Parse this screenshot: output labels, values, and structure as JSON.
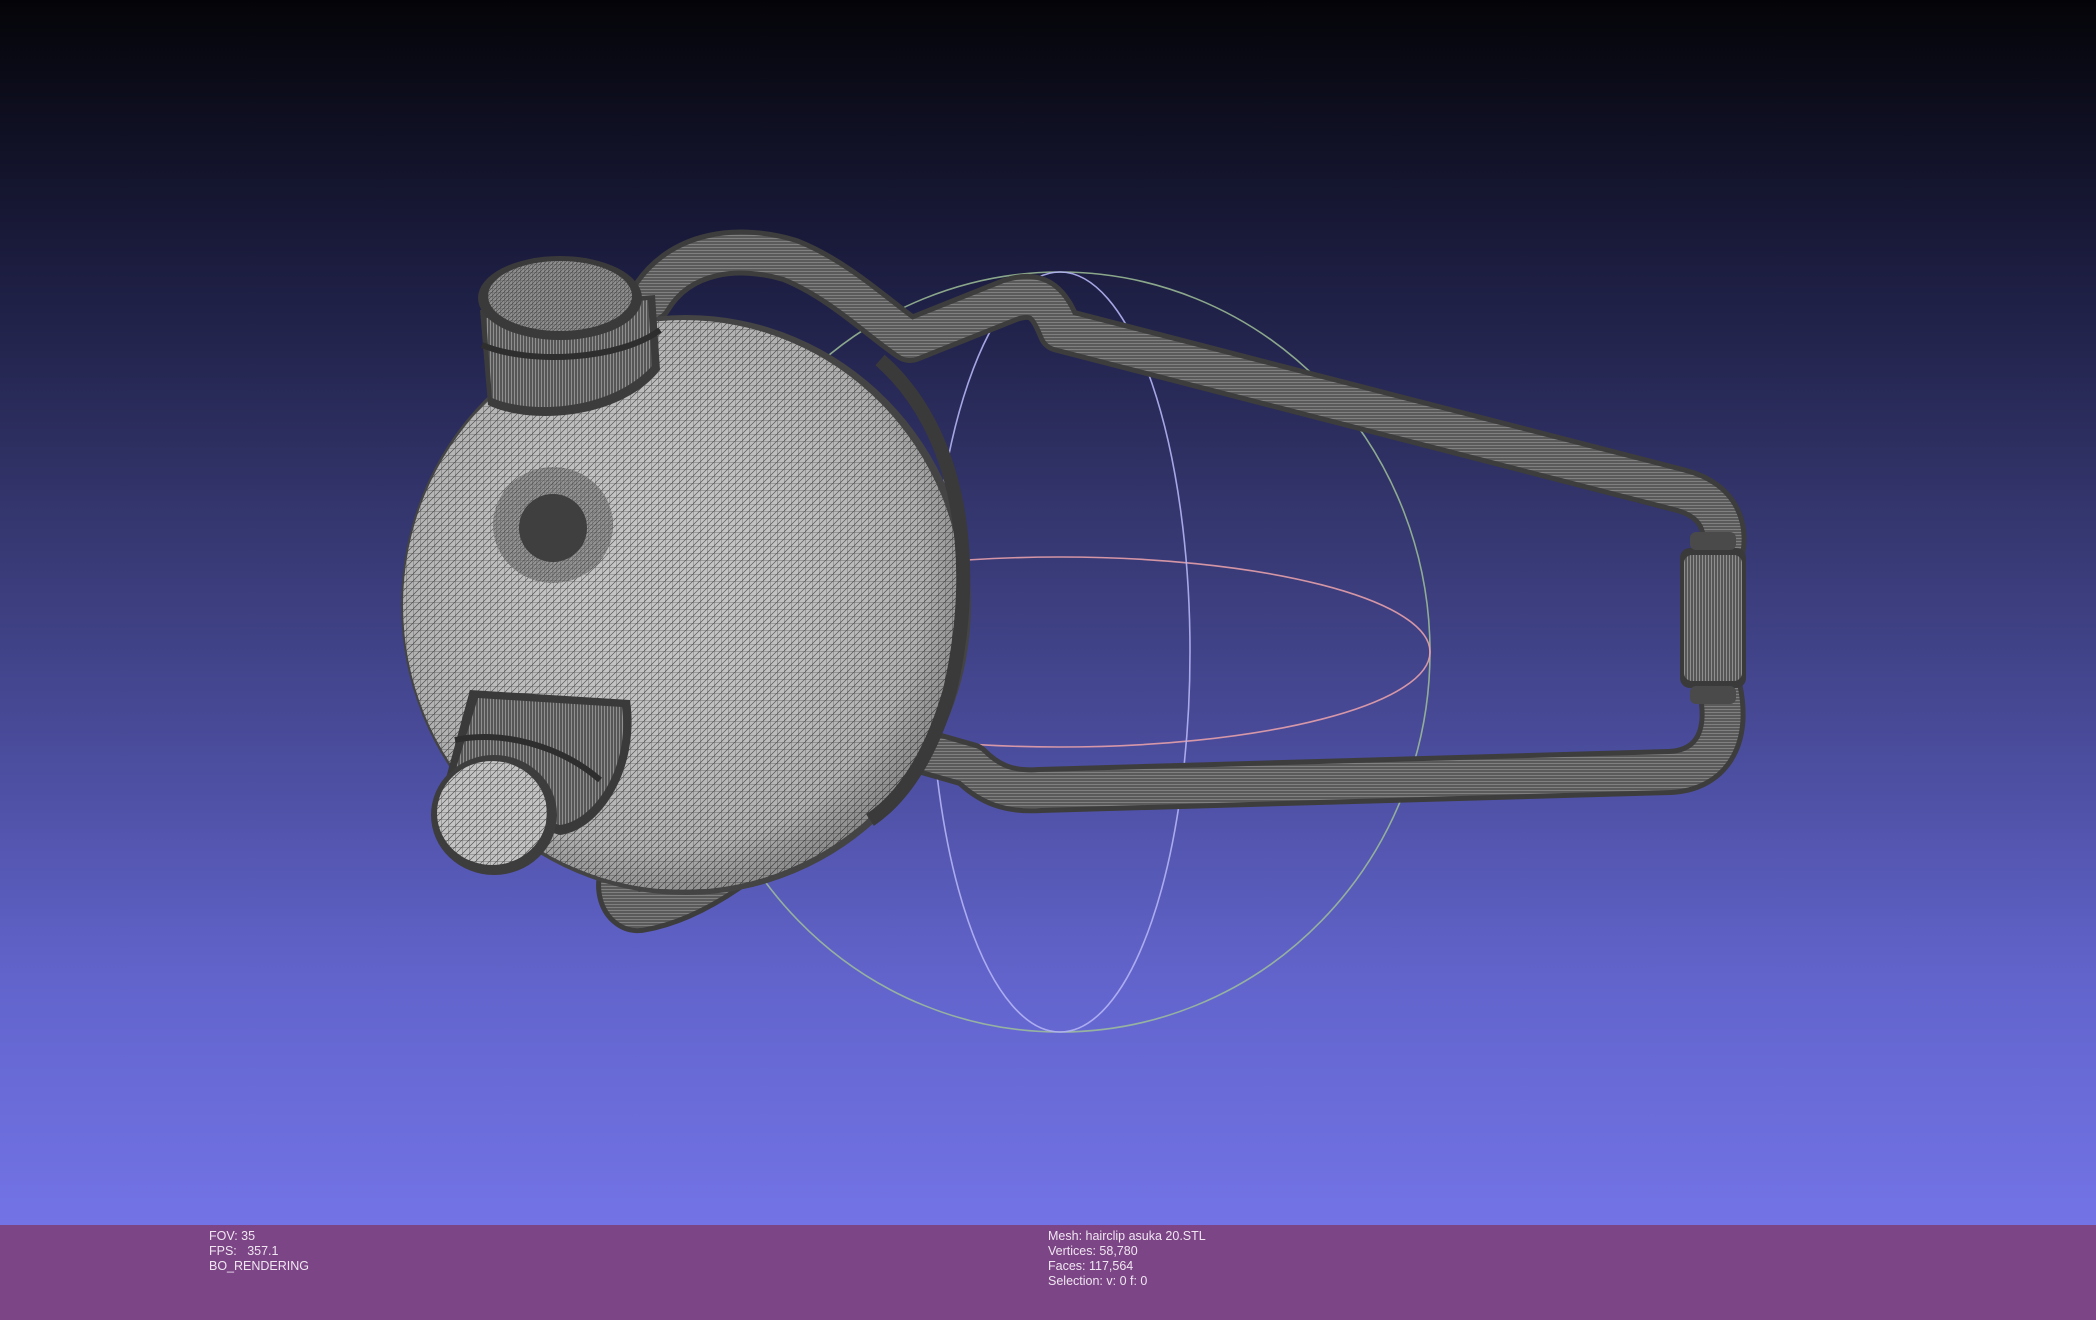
{
  "viewer": {
    "fov_label": "FOV: 35",
    "fps_label": "FPS:   357.1",
    "render_mode": "BO_RENDERING",
    "mesh_label": "Mesh: hairclip asuka 20.STL",
    "vertices_label": "Vertices: 58,780",
    "faces_label": "Faces: 117,564",
    "selection_label": "Selection: v: 0 f: 0"
  },
  "colors": {
    "background_top": "#040408",
    "background_bottom": "#7373e6",
    "statusbar": "#7c4585",
    "mesh_wire": "#4a4a4a",
    "mesh_fill": "#bdbdbd",
    "trackball_x": "#e8a0a8",
    "trackball_y": "#a8d0a0",
    "trackball_z": "#b0b0f0"
  }
}
